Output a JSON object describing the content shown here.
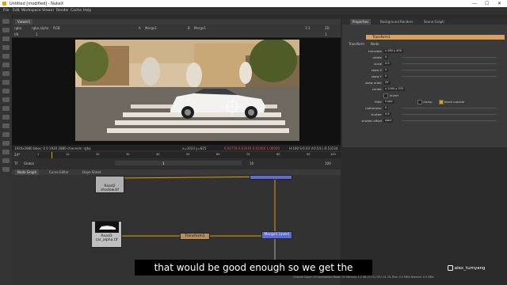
{
  "window": {
    "title": "Untitled [modified] - NukeX",
    "minimize": "—",
    "maximize": "☐",
    "close": "✕"
  },
  "menu": [
    "File",
    "Edit",
    "Workspace",
    "Viewer",
    "Render",
    "Cache",
    "Help"
  ],
  "viewer": {
    "tab": "Viewer1",
    "channels": "rgba",
    "alpha": "rgba.alpha",
    "colorspace": "RGB",
    "input_a": "A",
    "input_a_node": "Merge1",
    "input_b": "B",
    "input_b_node": "Merge1",
    "gain": "f/8",
    "zoom": "1:1",
    "mode": "2D",
    "gamma": "1",
    "frame_range": "1",
    "format": "1920x2880 bbox: 0 0 1920 2880 channels: rgba",
    "coords": "x=1033 y=825",
    "pixel_values": "0.02778 0.03016 0.01464 1.00000",
    "hsv": "H:100 S:0.03 V:0.54 L:0.53134"
  },
  "timeline": {
    "fps": "24*",
    "tc": "TF",
    "global": "Global",
    "current_frame": "1",
    "step": "10",
    "end_frame": "100",
    "ticks": [
      "1",
      "10",
      "20",
      "30",
      "40",
      "50",
      "60",
      "70",
      "80",
      "90",
      "100"
    ]
  },
  "nodegraph": {
    "tabs": [
      "Node Graph",
      "Curve Editor",
      "Dope Sheet"
    ],
    "nodes": {
      "read2": "Read2",
      "read2_file": "shadow.tif",
      "read3": "Read3",
      "read3_file": "car_alpha.tif",
      "transform": "Transform1",
      "merge": "Merge1 (over)"
    }
  },
  "properties": {
    "tabs": [
      "Properties",
      "Background Renders",
      "Scene Graph"
    ],
    "node_name": "Transform1",
    "subtabs": [
      "Transform",
      "Node"
    ],
    "rows": [
      {
        "label": "translate",
        "value": "x 280   y 400"
      },
      {
        "label": "rotate",
        "value": "0"
      },
      {
        "label": "scale",
        "value": "0.5"
      },
      {
        "label": "skew X",
        "value": "0"
      },
      {
        "label": "skew Y",
        "value": "0"
      },
      {
        "label": "skew order",
        "value": "XY"
      },
      {
        "label": "center",
        "value": "x 1160   y 333"
      },
      {
        "label": "",
        "value": "invert"
      },
      {
        "label": "filter",
        "value": "Cubic"
      },
      {
        "label": "motionblur",
        "value": "0"
      },
      {
        "label": "shutter",
        "value": "0.5"
      },
      {
        "label": "shutter offset",
        "value": "start"
      }
    ],
    "clamp": "clamp",
    "black_outside": "black outside"
  },
  "status": "Channel Count: 23  Localization Mode: On  Memory: 1.2 GB (3.1%)  CPU: 41.3%  Disk: 0.0 MB/s  Network: 0.0 MB/s",
  "subtitle": "that would be good enough so we get the",
  "watermark": "alex_tumyang"
}
